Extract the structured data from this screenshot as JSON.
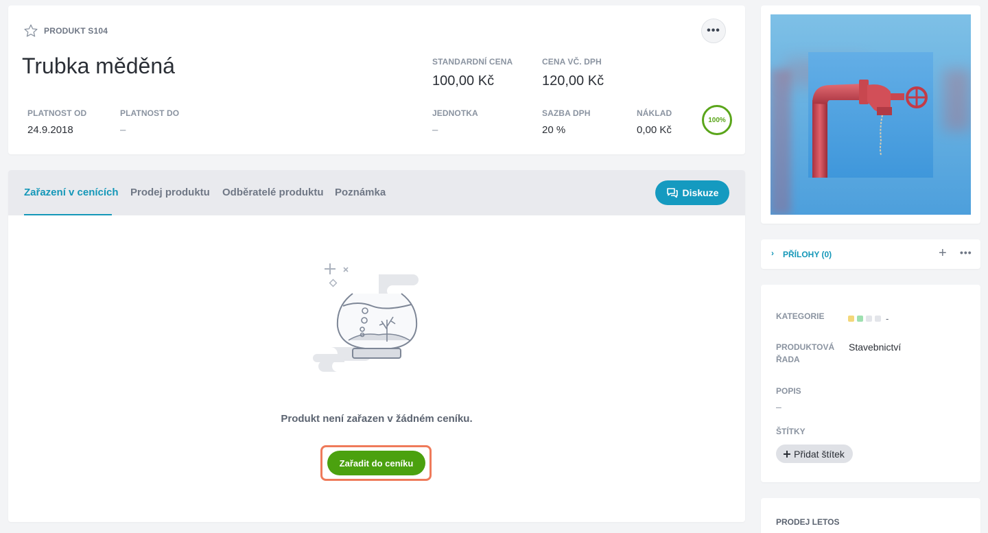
{
  "product": {
    "code": "PRODUKT S104",
    "title": "Trubka měděná",
    "more_label": "•••",
    "fields": {
      "standard_price_label": "STANDARDNÍ CENA",
      "standard_price": "100,00 Kč",
      "price_vat_label": "CENA VČ. DPH",
      "price_vat": "120,00 Kč",
      "valid_from_label": "PLATNOST OD",
      "valid_from": "24.9.2018",
      "valid_to_label": "PLATNOST DO",
      "valid_to": "–",
      "unit_label": "JEDNOTKA",
      "unit": "–",
      "vat_rate_label": "SAZBA DPH",
      "vat_rate": "20 %",
      "cost_label": "NÁKLAD",
      "cost": "0,00 Kč"
    },
    "completeness": "100%"
  },
  "tabs": [
    {
      "label": "Zařazení v cenících",
      "active": true
    },
    {
      "label": "Prodej produktu",
      "active": false
    },
    {
      "label": "Odběratelé produktu",
      "active": false
    },
    {
      "label": "Poznámka",
      "active": false
    }
  ],
  "discussion_button": "Diskuze",
  "empty_state": {
    "message": "Produkt není zařazen v žádném ceníku.",
    "action_label": "Zařadit do ceníku"
  },
  "sidebar": {
    "attachments": {
      "label": "PŘÍLOHY (0)",
      "add": "+",
      "more": "•••"
    },
    "info": {
      "category_label": "KATEGORIE",
      "category_value": "-",
      "category_colors": [
        "#f3d77a",
        "#9ee0b0",
        "#e3e5ea",
        "#e3e5ea"
      ],
      "product_line_label_1": "PRODUKTOVÁ",
      "product_line_label_2": "ŘADA",
      "product_line_value": "Stavebnictví",
      "description_label": "POPIS",
      "description_value": "–",
      "tags_label": "ŠTÍTKY",
      "add_tag": "Přidat štítek"
    },
    "sales_label": "PRODEJ LETOS"
  },
  "colors": {
    "accent": "#1497b8",
    "primary_green": "#4ba10f",
    "highlight": "#ef7a5a"
  }
}
